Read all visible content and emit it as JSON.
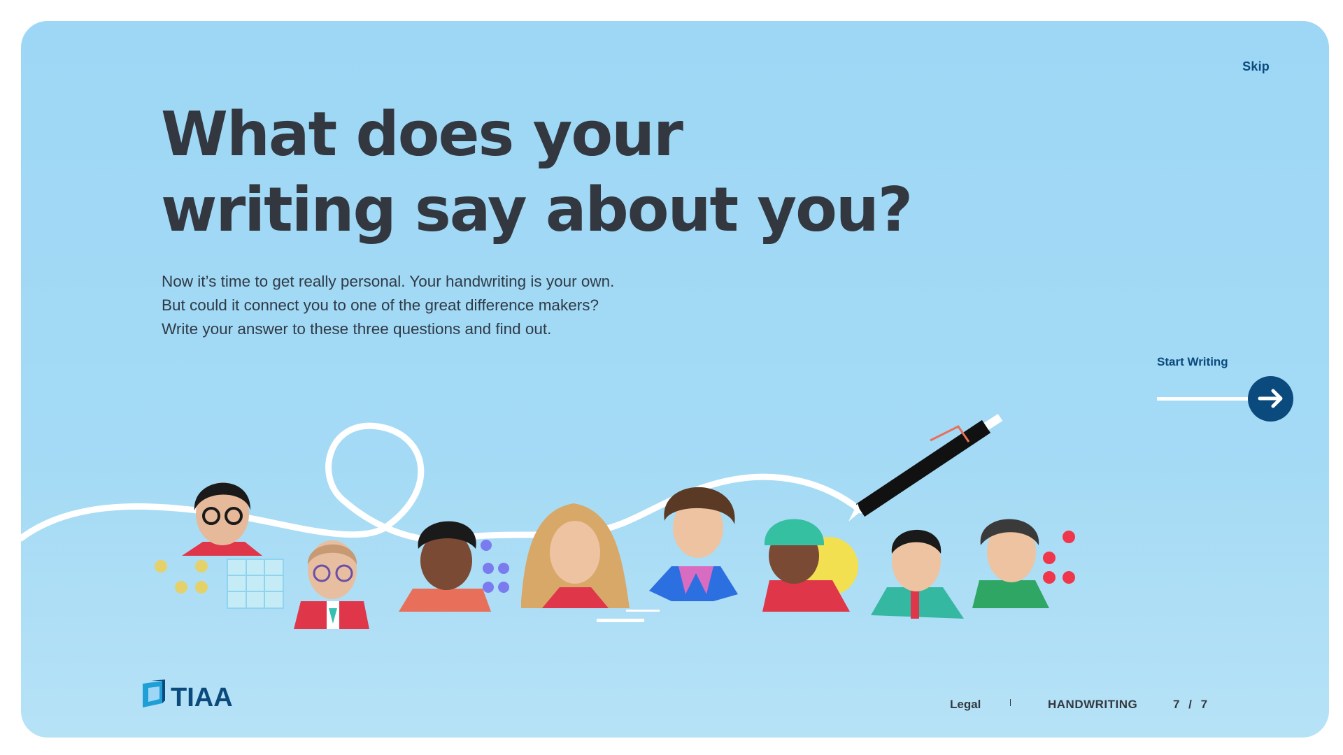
{
  "header": {
    "skip_label": "Skip"
  },
  "hero": {
    "title_line1": "What does your",
    "title_line2": "writing say about you?",
    "description": "Now it’s time to get really personal. Your handwriting is your own. But could it connect you to one of the great difference makers? Write your answer to these three questions and find out."
  },
  "cta": {
    "label": "Start Writing",
    "icon": "arrow-right-icon"
  },
  "footer": {
    "brand": "TIAA",
    "legal_label": "Legal",
    "section_label": "HANDWRITING",
    "page_indicator": "7 / 7"
  },
  "colors": {
    "background": "#9dd7f5",
    "accent": "#0b4a7d",
    "heading": "#333840",
    "text": "#2f3a46"
  }
}
